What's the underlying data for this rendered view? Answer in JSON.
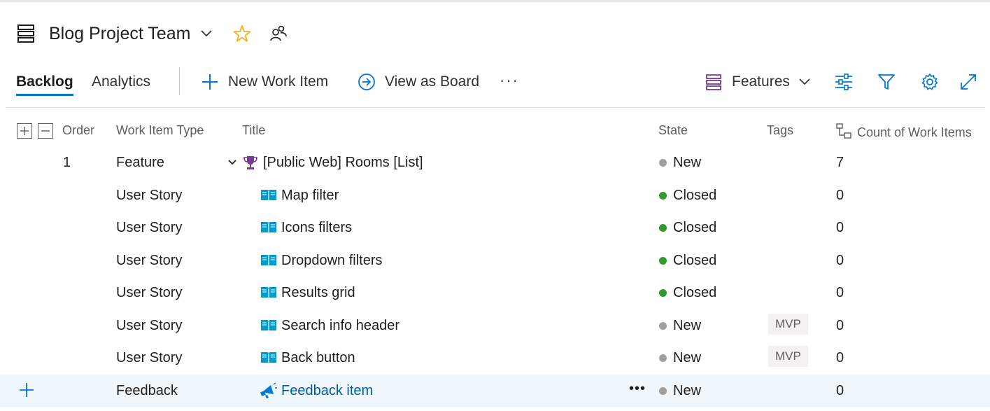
{
  "header": {
    "team_name": "Blog Project Team"
  },
  "toolbar": {
    "tabs": [
      {
        "label": "Backlog"
      },
      {
        "label": "Analytics"
      }
    ],
    "new_work_item": "New Work Item",
    "view_as_board": "View as Board",
    "more": "···",
    "backlog_level": "Features"
  },
  "grid": {
    "columns": [
      "Order",
      "Work Item Type",
      "Title",
      "State",
      "Tags",
      "Count of Work Items"
    ],
    "rows": [
      {
        "order": "1",
        "type": "Feature",
        "title": "[Public Web] Rooms [List]",
        "state": "New",
        "tag": "",
        "count": "7"
      },
      {
        "order": "",
        "type": "User Story",
        "title": "Map filter",
        "state": "Closed",
        "tag": "",
        "count": "0"
      },
      {
        "order": "",
        "type": "User Story",
        "title": "Icons filters",
        "state": "Closed",
        "tag": "",
        "count": "0"
      },
      {
        "order": "",
        "type": "User Story",
        "title": "Dropdown filters",
        "state": "Closed",
        "tag": "",
        "count": "0"
      },
      {
        "order": "",
        "type": "User Story",
        "title": "Results grid",
        "state": "Closed",
        "tag": "",
        "count": "0"
      },
      {
        "order": "",
        "type": "User Story",
        "title": "Search info header",
        "state": "New",
        "tag": "MVP",
        "count": "0"
      },
      {
        "order": "",
        "type": "User Story",
        "title": "Back button",
        "state": "New",
        "tag": "MVP",
        "count": "0"
      },
      {
        "order": "",
        "type": "Feedback",
        "title": "Feedback item",
        "state": "New",
        "tag": "",
        "count": "0",
        "row_more": "•••"
      }
    ]
  },
  "colors": {
    "accent": "#0078d4",
    "state_new": "#a19f9d",
    "state_closed": "#339933",
    "feature_purple": "#773b93",
    "story_blue": "#009ccc",
    "feedback_blue": "#0078d4",
    "star": "#f2b01e"
  },
  "icons": {
    "team": "backlog-icon",
    "favorite": "star-icon",
    "members": "people-icon",
    "feature": "trophy-icon",
    "story": "book-icon",
    "feedback": "megaphone-icon"
  }
}
